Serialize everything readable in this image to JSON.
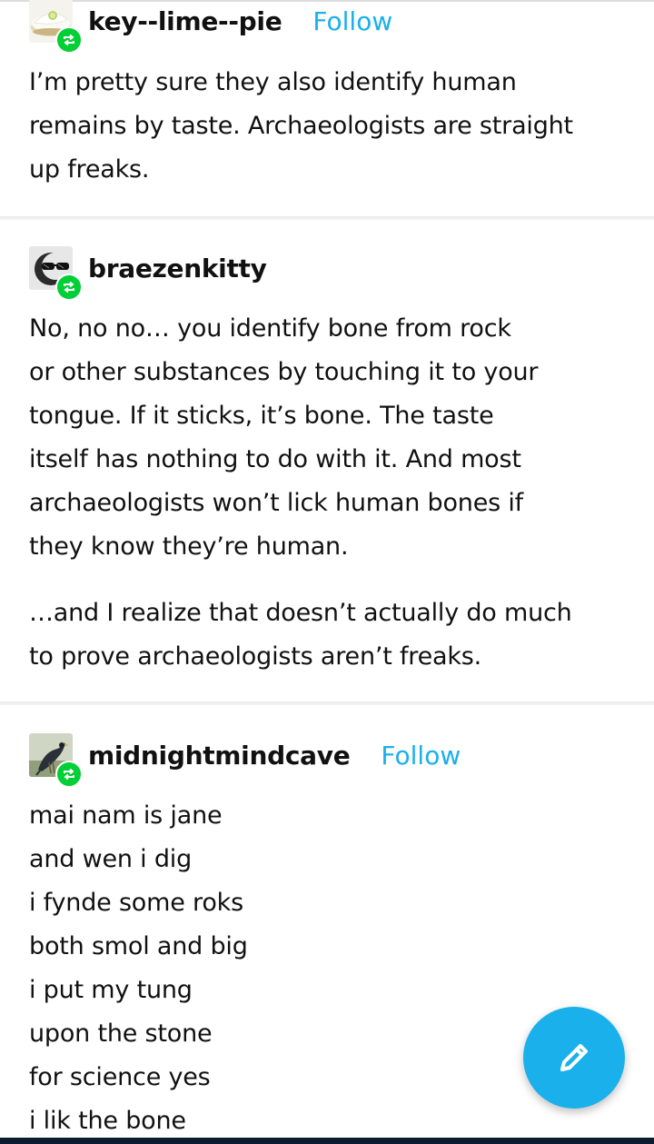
{
  "posts": [
    {
      "username": "key--lime--pie",
      "follow_label": "Follow",
      "avatar_icon": "key-lime-pie-avatar",
      "body_lines": [
        "I’m pretty sure they also identify human",
        "remains by taste. Archaeologists are straight",
        "up freaks."
      ]
    },
    {
      "username": "braezenkitty",
      "avatar_icon": "sunglasses-avatar",
      "paragraph1": [
        "No, no no… you identify bone from rock",
        "or other substances by touching it to your",
        "tongue. If it sticks, it’s bone. The taste",
        "itself has nothing to do with it. And most",
        "archaeologists won’t lick human bones if",
        "they know they’re human."
      ],
      "paragraph2": [
        "…and I realize that doesn’t actually do much",
        "to prove archaeologists aren’t freaks."
      ]
    },
    {
      "username": "midnightmindcave",
      "follow_label": "Follow",
      "avatar_icon": "bird-avatar",
      "body_lines": [
        "mai nam is jane",
        "and wen i dig",
        "i fynde some roks",
        "both smol and big",
        "i put my tung",
        "upon the stone",
        "for science yes",
        "i lik the bone"
      ]
    }
  ],
  "fab": {
    "icon": "pencil-icon"
  },
  "colors": {
    "follow": "#1ab0ec",
    "reblog_badge": "#00cf35",
    "fab": "#1ab0ec",
    "text": "#111111"
  }
}
